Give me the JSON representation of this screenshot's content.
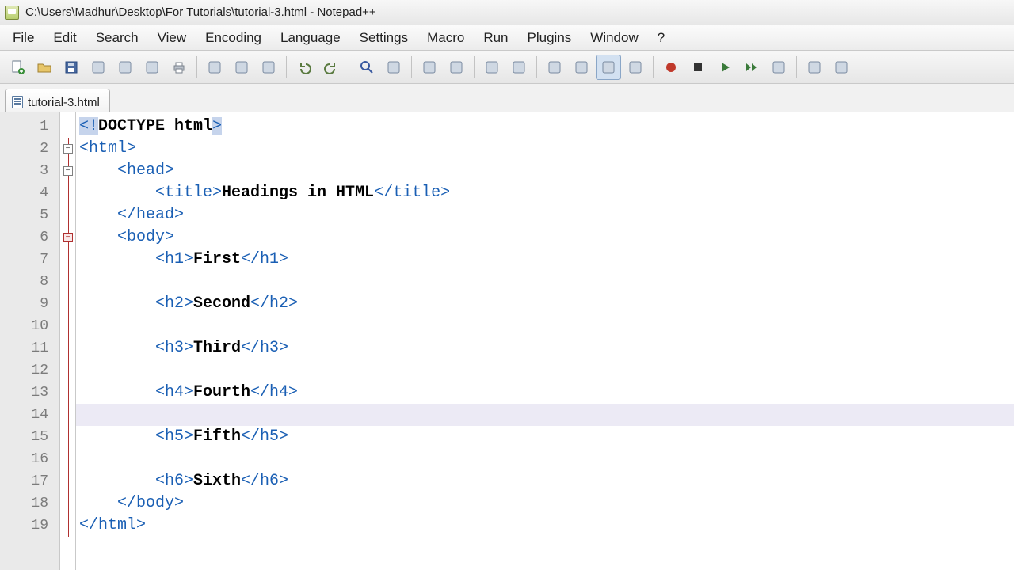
{
  "title_path": "C:\\Users\\Madhur\\Desktop\\For Tutorials\\tutorial-3.html - Notepad++",
  "menus": [
    "File",
    "Edit",
    "Search",
    "View",
    "Encoding",
    "Language",
    "Settings",
    "Macro",
    "Run",
    "Plugins",
    "Window",
    "?"
  ],
  "toolbar_icons": [
    "new-icon",
    "open-icon",
    "save-icon",
    "save-all-icon",
    "close-icon",
    "close-all-icon",
    "print-icon",
    "sep",
    "cut-icon",
    "copy-icon",
    "paste-icon",
    "sep",
    "undo-icon",
    "redo-icon",
    "sep",
    "find-icon",
    "replace-icon",
    "sep",
    "zoom-in-icon",
    "zoom-out-icon",
    "sep",
    "sync-v-icon",
    "sync-h-icon",
    "sep",
    "wordwrap-icon",
    "show-all-icon",
    "indent-guide-icon",
    "doc-map-icon",
    "sep",
    "record-macro-icon",
    "stop-macro-icon",
    "play-macro-icon",
    "play-fast-icon",
    "save-macro-icon",
    "sep",
    "folder-icon",
    "update-icon"
  ],
  "tab_label": "tutorial-3.html",
  "line_numbers": [
    "1",
    "2",
    "3",
    "4",
    "5",
    "6",
    "7",
    "8",
    "9",
    "10",
    "11",
    "12",
    "13",
    "14",
    "15",
    "16",
    "17",
    "18",
    "19"
  ],
  "current_line_index": 13,
  "fold": {
    "boxes": {
      "1": "minus-gray",
      "2": "minus-gray",
      "5": "minus-red"
    },
    "vline_from": 1,
    "vline_to": 18
  },
  "code_lines": [
    {
      "indent": 0,
      "segs": [
        {
          "t": "<",
          "c": "tag",
          "sel": true
        },
        {
          "t": "!",
          "c": "tag",
          "sel": true
        },
        {
          "t": "DOCTYPE html",
          "c": "txt"
        },
        {
          "t": ">",
          "c": "tag",
          "sel": true
        }
      ]
    },
    {
      "indent": 0,
      "segs": [
        {
          "t": "<html>",
          "c": "tag"
        }
      ]
    },
    {
      "indent": 1,
      "segs": [
        {
          "t": "<head>",
          "c": "tag"
        }
      ]
    },
    {
      "indent": 2,
      "segs": [
        {
          "t": "<title>",
          "c": "tag"
        },
        {
          "t": "Headings in HTML",
          "c": "txt"
        },
        {
          "t": "</title>",
          "c": "tag"
        }
      ]
    },
    {
      "indent": 1,
      "segs": [
        {
          "t": "</head>",
          "c": "tag"
        }
      ]
    },
    {
      "indent": 1,
      "segs": [
        {
          "t": "<body>",
          "c": "tag"
        }
      ]
    },
    {
      "indent": 2,
      "segs": [
        {
          "t": "<h1>",
          "c": "tag"
        },
        {
          "t": "First",
          "c": "txt"
        },
        {
          "t": "</h1>",
          "c": "tag"
        }
      ]
    },
    {
      "indent": 2,
      "segs": []
    },
    {
      "indent": 2,
      "segs": [
        {
          "t": "<h2>",
          "c": "tag"
        },
        {
          "t": "Second",
          "c": "txt"
        },
        {
          "t": "</h2>",
          "c": "tag"
        }
      ]
    },
    {
      "indent": 2,
      "segs": []
    },
    {
      "indent": 2,
      "segs": [
        {
          "t": "<h3>",
          "c": "tag"
        },
        {
          "t": "Third",
          "c": "txt"
        },
        {
          "t": "</h3>",
          "c": "tag"
        }
      ]
    },
    {
      "indent": 2,
      "segs": []
    },
    {
      "indent": 2,
      "segs": [
        {
          "t": "<h4>",
          "c": "tag"
        },
        {
          "t": "Fourth",
          "c": "txt"
        },
        {
          "t": "</h4>",
          "c": "tag"
        }
      ]
    },
    {
      "indent": 2,
      "segs": []
    },
    {
      "indent": 2,
      "segs": [
        {
          "t": "<h5>",
          "c": "tag"
        },
        {
          "t": "Fifth",
          "c": "txt"
        },
        {
          "t": "</h5>",
          "c": "tag"
        }
      ]
    },
    {
      "indent": 2,
      "segs": []
    },
    {
      "indent": 2,
      "segs": [
        {
          "t": "<h6>",
          "c": "tag"
        },
        {
          "t": "Sixth",
          "c": "txt"
        },
        {
          "t": "</h6>",
          "c": "tag"
        }
      ]
    },
    {
      "indent": 1,
      "segs": [
        {
          "t": "</body>",
          "c": "tag"
        }
      ]
    },
    {
      "indent": 0,
      "segs": [
        {
          "t": "</html>",
          "c": "tag"
        }
      ]
    }
  ]
}
